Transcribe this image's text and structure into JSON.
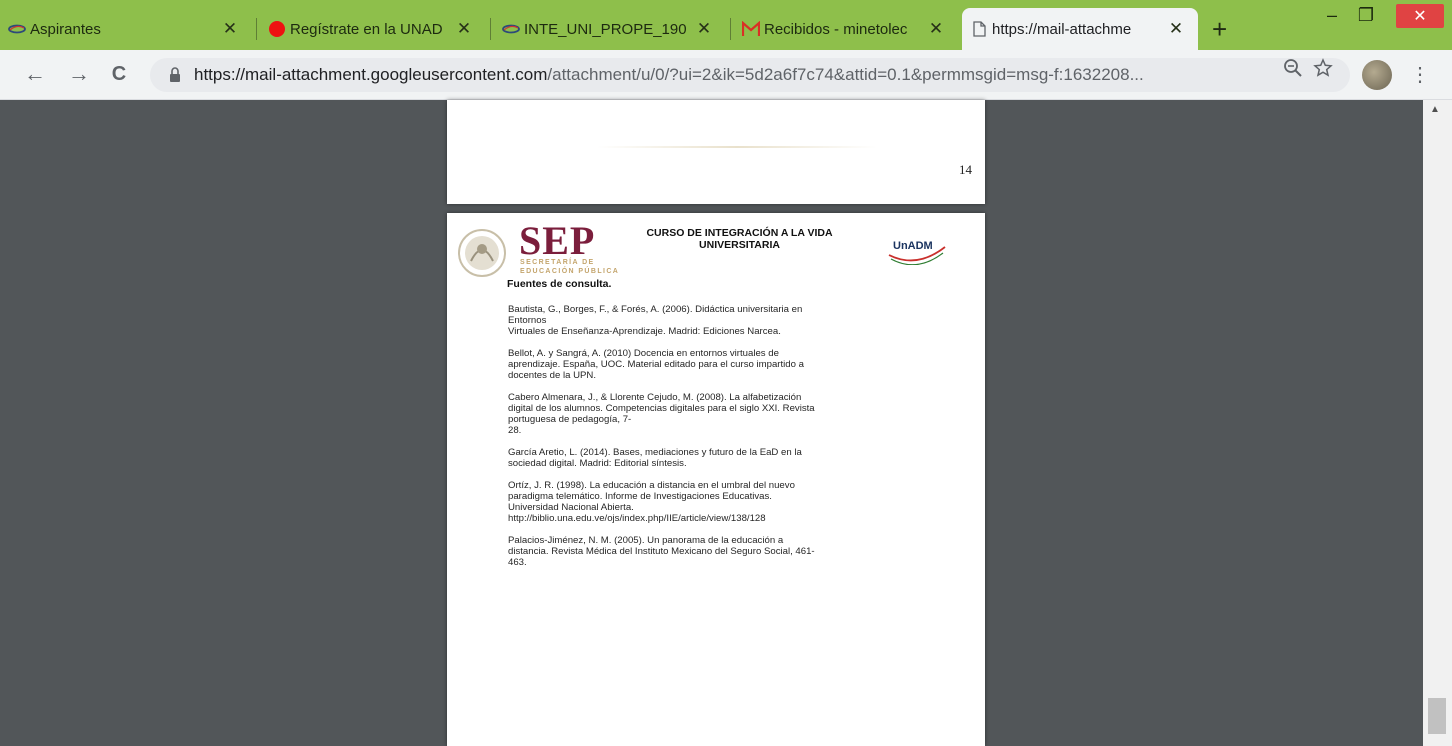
{
  "tabs": [
    {
      "label": "Aspirantes",
      "icon": "unadm-favicon",
      "active": false
    },
    {
      "label": "Regístrate en la UNAD",
      "icon": "red-circle-favicon",
      "active": false
    },
    {
      "label": "INTE_UNI_PROPE_190",
      "icon": "unadm-favicon",
      "active": false
    },
    {
      "label": "Recibidos - minetolec",
      "icon": "gmail-favicon",
      "active": false
    },
    {
      "label": "https://mail-attachme",
      "icon": "document-icon",
      "active": true
    }
  ],
  "window_controls": {
    "minimize": "–",
    "maximize": "❐",
    "close": "✕"
  },
  "toolbar": {
    "back": "←",
    "forward": "→",
    "reload": "C",
    "url_host": "https://mail-attachment.googleusercontent.com",
    "url_path": "/attachment/u/0/?ui=2&ik=5d2a6f7c74&attid=0.1&permmsgid=msg-f:1632208...",
    "zoom_icon": "magnifier-minus-icon",
    "star_icon": "star-icon",
    "menu": "⋮"
  },
  "page1": {
    "page_number": "14"
  },
  "page2": {
    "sep_logo": "SEP",
    "sep_sub_line1": "SECRETARÍA DE",
    "sep_sub_line2": "EDUCACIÓN PÚBLICA",
    "course_title_line1": "CURSO DE INTEGRACIÓN A LA VIDA",
    "course_title_line2": "UNIVERSITARIA",
    "unadm_logo": "UnADM",
    "sources_title": "Fuentes de consulta.",
    "references": [
      {
        "lines": [
          "Bautista, G., Borges, F., & Forés, A. (2006). Didáctica universitaria en",
          "Entornos",
          "Virtuales de Enseñanza-Aprendizaje. Madrid: Ediciones Narcea."
        ]
      },
      {
        "lines": [
          "Bellot, A. y Sangrá, A. (2010) Docencia en entornos virtuales de",
          "aprendizaje. España, UOC. Material editado para el curso impartido a",
          "docentes de la UPN."
        ]
      },
      {
        "lines": [
          "Cabero Almenara, J., & Llorente Cejudo, M. (2008). La alfabetización",
          "digital de los alumnos. Competencias digitales para el siglo XXI. Revista",
          "portuguesa de pedagogía, 7-",
          "28."
        ]
      },
      {
        "lines": [
          "García Aretio, L. (2014). Bases, mediaciones y futuro de la EaD en la",
          "sociedad digital. Madrid: Editorial síntesis."
        ]
      },
      {
        "lines": [
          "Ortíz, J. R. (1998). La educación a distancia en el umbral del nuevo",
          "paradigma telemático.   Informe   de Investigaciones   Educativas.",
          "Universidad   Nacional Abierta.",
          "http://biblio.una.edu.ve/ojs/index.php/IIE/article/view/138/128"
        ]
      },
      {
        "lines": [
          "Palacios-Jiménez, N. M. (2005). Un panorama de la educación a",
          "distancia.  Revista Médica del Instituto Mexicano del Seguro Social, 461-",
          "463."
        ]
      }
    ]
  }
}
